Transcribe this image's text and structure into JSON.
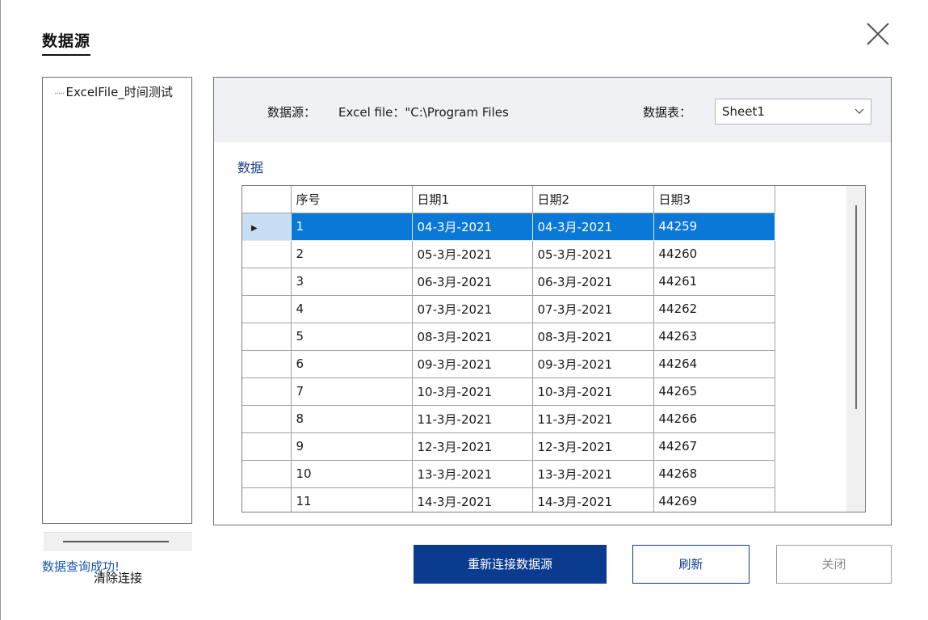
{
  "dialog": {
    "title": "数据源",
    "close_icon": "close-icon"
  },
  "sidebar": {
    "tree_item": "ExcelFile_时间测试",
    "clear_button": "清除连接"
  },
  "header": {
    "source_label": "数据源：",
    "source_value": "Excel file：\"C:\\Program Files",
    "sheet_label": "数据表：",
    "sheet_value": "Sheet1"
  },
  "data_section": {
    "label": "数据",
    "columns": [
      "序号",
      "日期1",
      "日期2",
      "日期3"
    ],
    "rows": [
      [
        "1",
        "04-3月-2021",
        "04-3月-2021",
        "44259"
      ],
      [
        "2",
        "05-3月-2021",
        "05-3月-2021",
        "44260"
      ],
      [
        "3",
        "06-3月-2021",
        "06-3月-2021",
        "44261"
      ],
      [
        "4",
        "07-3月-2021",
        "07-3月-2021",
        "44262"
      ],
      [
        "5",
        "08-3月-2021",
        "08-3月-2021",
        "44263"
      ],
      [
        "6",
        "09-3月-2021",
        "09-3月-2021",
        "44264"
      ],
      [
        "7",
        "10-3月-2021",
        "10-3月-2021",
        "44265"
      ],
      [
        "8",
        "11-3月-2021",
        "11-3月-2021",
        "44266"
      ],
      [
        "9",
        "12-3月-2021",
        "12-3月-2021",
        "44267"
      ],
      [
        "10",
        "13-3月-2021",
        "13-3月-2021",
        "44268"
      ],
      [
        "11",
        "14-3月-2021",
        "14-3月-2021",
        "44269"
      ]
    ],
    "selected_row": 0
  },
  "footer": {
    "status": "数据查询成功!",
    "reconnect_button": "重新连接数据源",
    "refresh_button": "刷新",
    "close_button": "关闭"
  },
  "colors": {
    "primary": "#0b3b8f",
    "selection": "#0a78d6",
    "status_text": "#1a55b0"
  }
}
